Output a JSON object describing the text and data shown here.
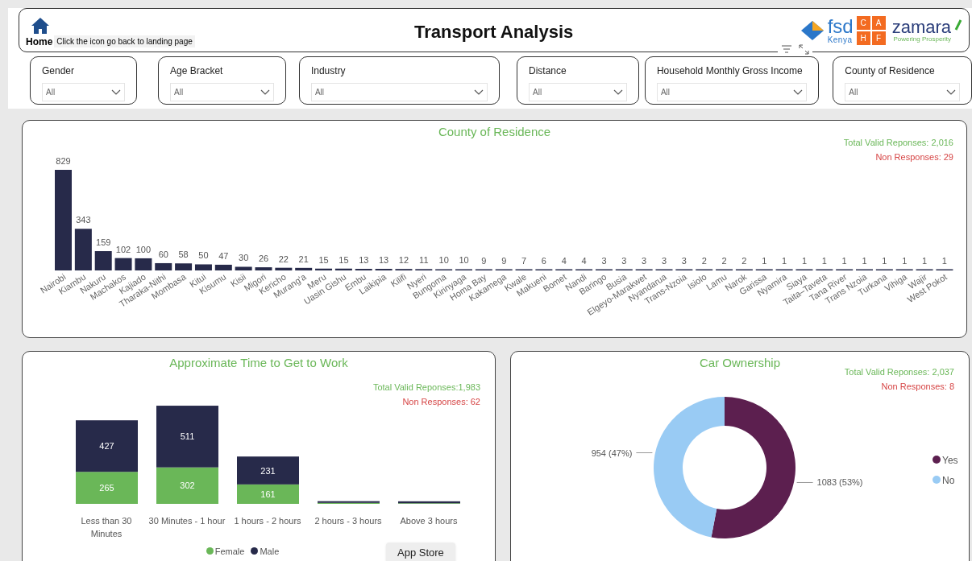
{
  "header": {
    "home_label": "Home",
    "hint": "Click the icon go back to landing page",
    "title": "Transport Analysis",
    "logos": {
      "fsd": "fsd",
      "fsd_sub": "Kenya",
      "cahf": [
        "C",
        "A",
        "H",
        "F"
      ],
      "zamara": "zamara",
      "zamara_sub": "Powering Prosperity"
    }
  },
  "filters": [
    {
      "label": "Gender",
      "value": "All"
    },
    {
      "label": "Age Bracket",
      "value": "All"
    },
    {
      "label": "Industry",
      "value": "All"
    },
    {
      "label": "Distance",
      "value": "All"
    },
    {
      "label": "Household Monthly Gross Income",
      "value": "All"
    },
    {
      "label": "County of Residence",
      "value": "All"
    }
  ],
  "county_panel": {
    "title": "County of Residence",
    "total": "Total Valid Reponses: 2,016",
    "non_responses": "Non Responses: 29",
    "chart_data": {
      "type": "bar",
      "data_labels": true,
      "categories": [
        "Nairobi",
        "Kiambu",
        "Nakuru",
        "Machakos",
        "Kajiado",
        "Tharaka-Nithi",
        "Mombasa",
        "Kitui",
        "Kisumu",
        "Kisii",
        "Migori",
        "Kericho",
        "Murang'a",
        "Meru",
        "Uasin Gishu",
        "Embu",
        "Laikipia",
        "Kilifi",
        "Nyeri",
        "Bungoma",
        "Kirinyaga",
        "Homa Bay",
        "Kakamega",
        "Kwale",
        "Makueni",
        "Bomet",
        "Nandi",
        "Baringo",
        "Busia",
        "Elgeyo-Marakwet",
        "Nyandarua",
        "Trans-Nzoia",
        "Isiolo",
        "Lamu",
        "Narok",
        "Garissa",
        "Nyamira",
        "Siaya",
        "Taita–Taveta",
        "Tana River",
        "Trans Nzoia",
        "Turkana",
        "Vihiga",
        "Wajir",
        "West Pokot"
      ],
      "series": [
        {
          "color": "#272a4a",
          "values": [
            829,
            343,
            159,
            102,
            100,
            60,
            58,
            50,
            47,
            30,
            26,
            22,
            21,
            15,
            15,
            13,
            13,
            12,
            11,
            10,
            10,
            9,
            9,
            7,
            6,
            4,
            4,
            3,
            3,
            3,
            3,
            3,
            2,
            2,
            2,
            1,
            1,
            1,
            1,
            1,
            1,
            1,
            1,
            1,
            1
          ]
        }
      ]
    }
  },
  "time_panel": {
    "title": "Approximate Time to Get to Work",
    "total": "Total Valid Reponses:1,983",
    "non_responses": "Non Responses: 62",
    "chart_data": {
      "type": "bar",
      "stacked": true,
      "legend": "bottom",
      "categories": [
        "Less than 30 Minutes",
        "30 Minutes - 1 hour",
        "1 hours - 2 hours",
        "2 hours - 3 hours",
        "Above 3 hours"
      ],
      "series": [
        {
          "name": "Female",
          "color": "#6ab758",
          "values": [
            265,
            302,
            161,
            8,
            5
          ],
          "value_labels": [
            "265",
            "302",
            "161",
            null,
            null
          ]
        },
        {
          "name": "Male",
          "color": "#272a4a",
          "values": [
            427,
            511,
            231,
            14,
            16
          ],
          "value_labels": [
            "427",
            "511",
            "231",
            null,
            null
          ]
        }
      ]
    }
  },
  "app_store_button": "App Store",
  "car_panel": {
    "title": "Car Ownership",
    "total": "Total Valid Reponses: 2,037",
    "non_responses": "Non Responses: 8",
    "chart_data": {
      "type": "donut",
      "legend": "right",
      "value_labels": [
        "1083 (53%)",
        "954 (47%)"
      ],
      "categories": [
        "Yes",
        "No"
      ],
      "series": [
        {
          "values": [
            53,
            47
          ]
        }
      ],
      "colors": [
        "#5c1f4f",
        "#99cbf4"
      ]
    }
  }
}
